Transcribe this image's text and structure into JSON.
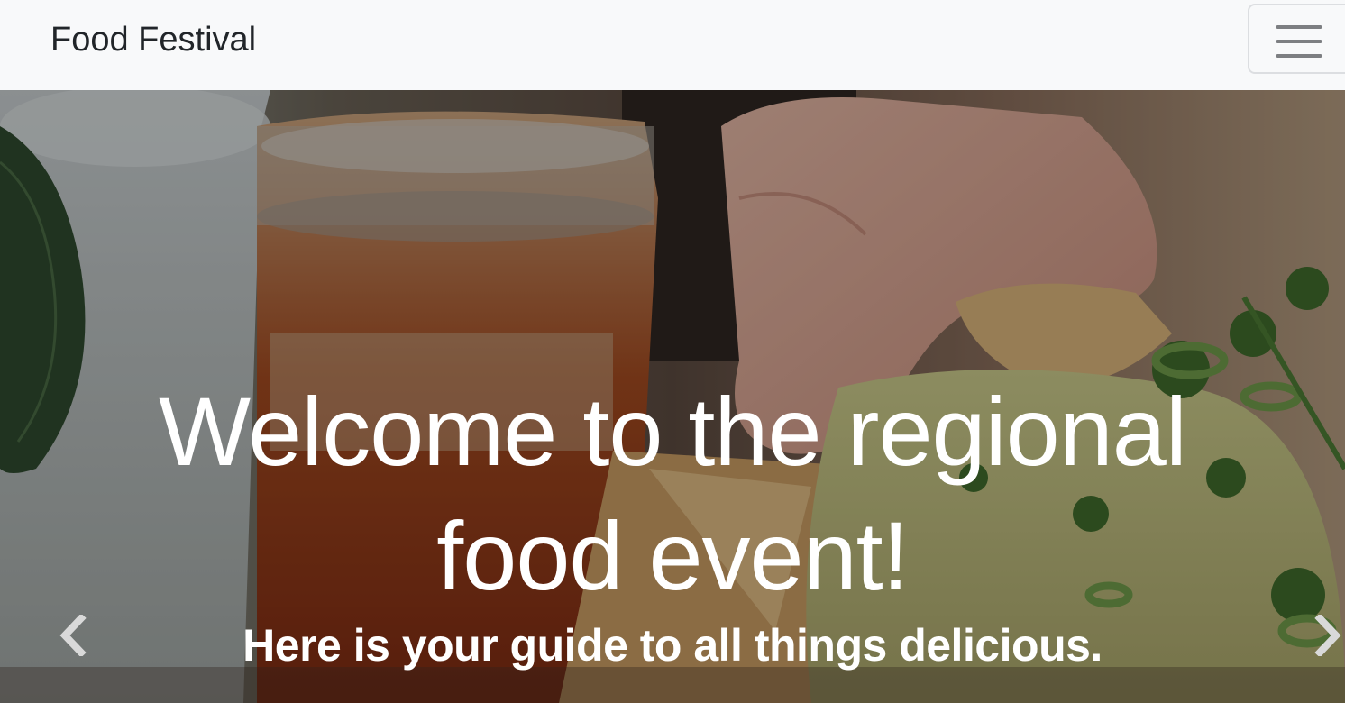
{
  "navbar": {
    "brand": "Food Festival",
    "toggler_icon": "hamburger-menu-icon"
  },
  "hero": {
    "title_line1": "Welcome to the regional",
    "title_line2": "food event!",
    "subtitle": "Here is your guide to all things delicious.",
    "prev_icon": "chevron-left-icon",
    "next_icon": "chevron-right-icon"
  },
  "colors": {
    "navbar_bg": "#f8f9fa",
    "brand_text": "#212529",
    "hero_text": "#ffffff",
    "toggler_bars": "#7d7f82"
  }
}
